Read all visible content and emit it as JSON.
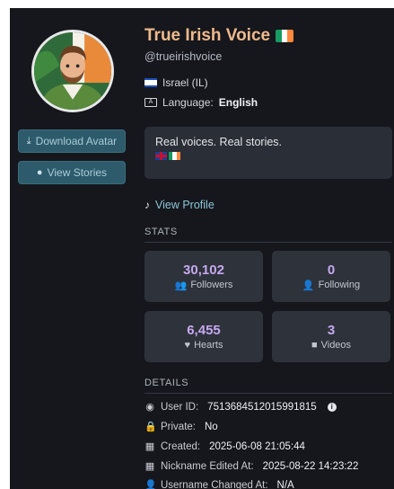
{
  "profile": {
    "display_name": "True Irish Voice",
    "handle": "@trueirishvoice",
    "country": "Israel (IL)",
    "language_label": "Language:",
    "language_value": "English",
    "bio": "Real voices. Real stories.",
    "avatar_alt": "profile-avatar"
  },
  "actions": {
    "download_avatar": "Download Avatar",
    "view_stories": "View Stories",
    "view_profile": "View Profile"
  },
  "stats_section": {
    "title": "STATS",
    "followers": {
      "value": "30,102",
      "label": "Followers"
    },
    "following": {
      "value": "0",
      "label": "Following"
    },
    "hearts": {
      "value": "6,455",
      "label": "Hearts"
    },
    "videos": {
      "value": "3",
      "label": "Videos"
    }
  },
  "details_section": {
    "title": "DETAILS",
    "user_id": {
      "label": "User ID:",
      "value": "7513684512015991815"
    },
    "private": {
      "label": "Private:",
      "value": "No"
    },
    "created": {
      "label": "Created:",
      "value": "2025-06-08 21:05:44"
    },
    "nickname_edited": {
      "label": "Nickname Edited At:",
      "value": "2025-08-22 14:23:22"
    },
    "username_changed": {
      "label": "Username Changed At:",
      "value": "N/A"
    }
  },
  "colors": {
    "background": "#15171c",
    "card": "#2e323a",
    "accent_title": "#f0b98c",
    "accent_stat": "#c6a8f0",
    "button": "#2d5b6b",
    "link": "#8cc6d8"
  }
}
